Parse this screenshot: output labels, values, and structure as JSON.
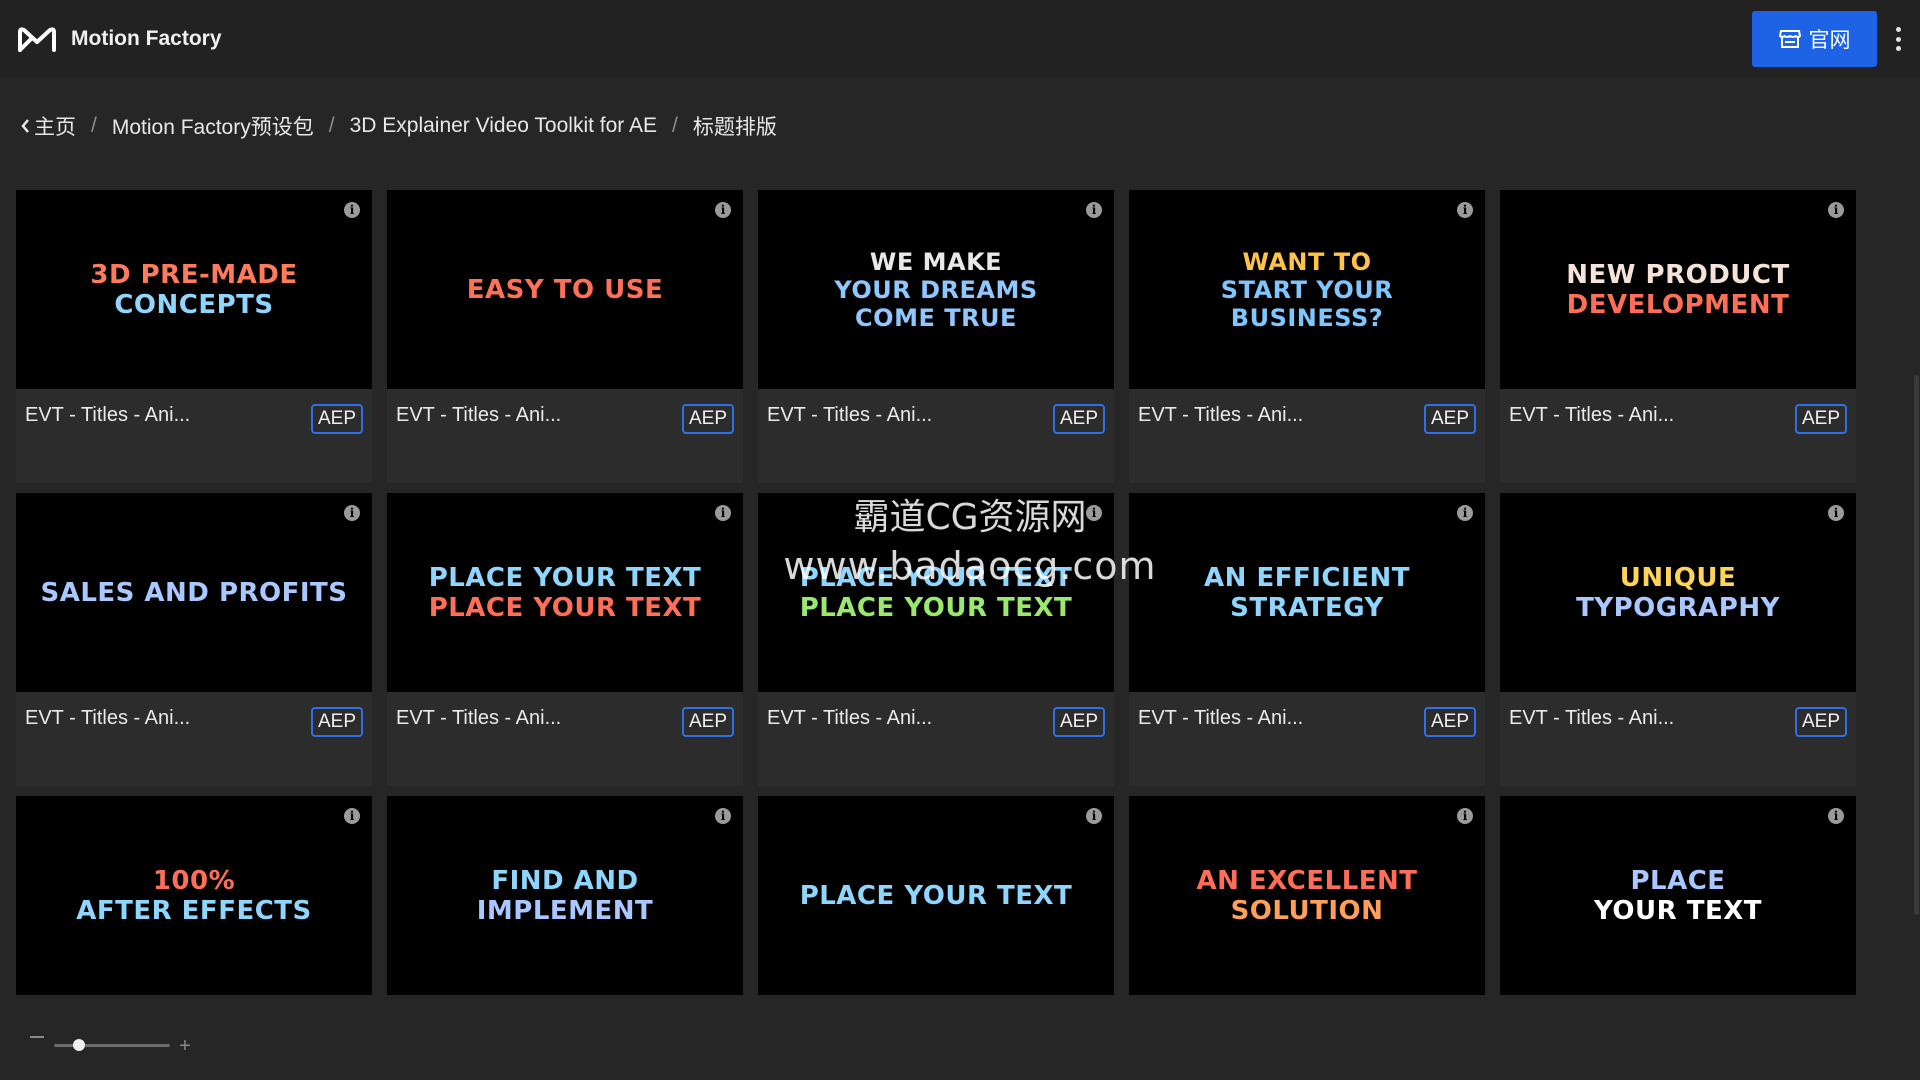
{
  "app": {
    "title": "Motion Factory",
    "site_button_label": "官网"
  },
  "breadcrumb": {
    "back_label": "主页",
    "items": [
      "Motion Factory预设包",
      "3D Explainer Video Toolkit for AE",
      "标题排版"
    ]
  },
  "cards": [
    {
      "name": "EVT - Titles - Ani...",
      "format": "AEP",
      "thumb_lines": [
        "3D PRE-MADE",
        "CONCEPTS"
      ],
      "thumb_color": "#ff7b5c",
      "thumb_color2": "#8fd6ff"
    },
    {
      "name": "EVT - Titles - Ani...",
      "format": "AEP",
      "thumb_lines": [
        "EASY TO USE"
      ],
      "thumb_color": "#ff7058",
      "thumb_color2": "#ff7058"
    },
    {
      "name": "EVT - Titles - Ani...",
      "format": "AEP",
      "thumb_lines": [
        "WE MAKE",
        "YOUR DREAMS",
        "COME TRUE"
      ],
      "thumb_color": "#e9e9e9",
      "thumb_color2": "#8fc7ff"
    },
    {
      "name": "EVT - Titles - Ani...",
      "format": "AEP",
      "thumb_lines": [
        "WANT TO",
        "START YOUR",
        "BUSINESS?"
      ],
      "thumb_color": "#ffc24a",
      "thumb_color2": "#7fc6ff"
    },
    {
      "name": "EVT - Titles - Ani...",
      "format": "AEP",
      "thumb_lines": [
        "NEW PRODUCT",
        "DEVELOPMENT"
      ],
      "thumb_color": "#f5e3d8",
      "thumb_color2": "#ff6f57"
    },
    {
      "name": "EVT - Titles - Ani...",
      "format": "AEP",
      "thumb_lines": [
        "SALES AND PROFITS"
      ],
      "thumb_color": "#a9c8ff",
      "thumb_color2": "#a9c8ff"
    },
    {
      "name": "EVT - Titles - Ani...",
      "format": "AEP",
      "thumb_lines": [
        "PLACE YOUR TEXT",
        "PLACE YOUR TEXT"
      ],
      "thumb_color": "#8fd6ff",
      "thumb_color2": "#ff6f57"
    },
    {
      "name": "EVT - Titles - Ani...",
      "format": "AEP",
      "thumb_lines": [
        "PLACE YOUR TEXT",
        "PLACE YOUR TEXT"
      ],
      "thumb_color": "#8fd6ff",
      "thumb_color2": "#9be86f"
    },
    {
      "name": "EVT - Titles - Ani...",
      "format": "AEP",
      "thumb_lines": [
        "AN EFFICIENT",
        "STRATEGY"
      ],
      "thumb_color": "#8fd6ff",
      "thumb_color2": "#8fd6ff"
    },
    {
      "name": "EVT - Titles - Ani...",
      "format": "AEP",
      "thumb_lines": [
        "UNIQUE",
        "TYPOGRAPHY"
      ],
      "thumb_color": "#ffd35a",
      "thumb_color2": "#a9c8ff"
    },
    {
      "name": "",
      "format": "",
      "thumb_lines": [
        "100%",
        "AFTER EFFECTS"
      ],
      "thumb_color": "#ff6f57",
      "thumb_color2": "#8fd6ff"
    },
    {
      "name": "",
      "format": "",
      "thumb_lines": [
        "FIND AND",
        "IMPLEMENT"
      ],
      "thumb_color": "#8fd6ff",
      "thumb_color2": "#a9c8ff"
    },
    {
      "name": "",
      "format": "",
      "thumb_lines": [
        "PLACE YOUR TEXT"
      ],
      "thumb_color": "#8fd6ff",
      "thumb_color2": "#8fd6ff"
    },
    {
      "name": "",
      "format": "",
      "thumb_lines": [
        "AN EXCELLENT",
        "SOLUTION"
      ],
      "thumb_color": "#ff6f57",
      "thumb_color2": "#ff9f5a"
    },
    {
      "name": "",
      "format": "",
      "thumb_lines": [
        "PLACE",
        "YOUR TEXT"
      ],
      "thumb_color": "#a9c8ff",
      "thumb_color2": "#ffffff"
    }
  ],
  "watermark": {
    "line1": "霸道CG资源网",
    "line2": "www.badaocg.com"
  }
}
